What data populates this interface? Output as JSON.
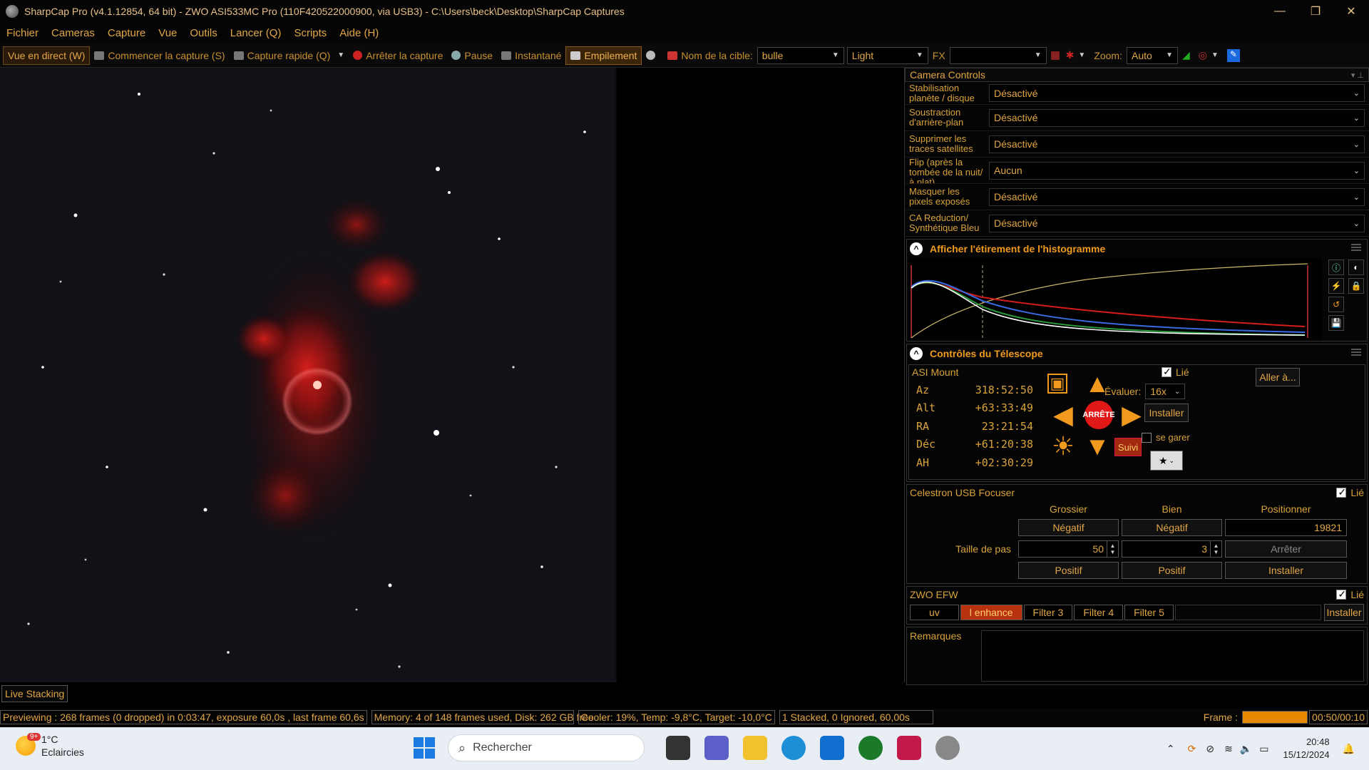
{
  "titlebar": {
    "title": "SharpCap Pro (v4.1.12854, 64 bit) - ZWO ASI533MC Pro (110F420522000900, via USB3) - C:\\Users\\beck\\Desktop\\SharpCap Captures",
    "minimize": "—",
    "maximize": "❐",
    "close": "✕"
  },
  "menu": [
    "Fichier",
    "Cameras",
    "Capture",
    "Vue",
    "Outils",
    "Lancer (Q)",
    "Scripts",
    "Aide (H)"
  ],
  "toolbar": {
    "live_view": "Vue en direct (W)",
    "start_capture": "Commencer la capture (S)",
    "quick_capture": "Capture rapide (Q)",
    "stop_capture": "Arrêter la capture",
    "pause": "Pause",
    "snapshot": "Instantané",
    "stacking": "Empilement",
    "target_label": "Nom de la cible:",
    "target_value": "bulle",
    "frame_type": "Light",
    "fx_label": "FX",
    "fx_value": "",
    "zoom_label": "Zoom:",
    "zoom_value": "Auto"
  },
  "panel": {
    "title": "Camera Controls",
    "settings": [
      {
        "label": "Stabilisation planète / disque",
        "value": "Désactivé"
      },
      {
        "label": "Soustraction d'arrière-plan",
        "value": "Désactivé"
      },
      {
        "label": "Supprimer les traces satellites",
        "value": "Désactivé"
      },
      {
        "label": "Flip (après la tombée de la nuit/à plat)",
        "value": "Aucun"
      },
      {
        "label": "Masquer les pixels exposés",
        "value": "Désactivé"
      },
      {
        "label": "CA Reduction/ Synthétique Bleu",
        "value": "Désactivé"
      }
    ],
    "histogram": {
      "title": "Afficher l'étirement de l'histogramme"
    },
    "telescope": {
      "title": "Contrôles du Télescope",
      "mount": "ASI Mount",
      "linked": "Lié",
      "goto": "Aller à...",
      "coords": [
        {
          "k": "Az",
          "v": "318:52:50"
        },
        {
          "k": "Alt",
          "v": "+63:33:49"
        },
        {
          "k": "RA",
          "v": "23:21:54"
        },
        {
          "k": "Déc",
          "v": "+61:20:38"
        },
        {
          "k": "AH",
          "v": "+02:30:29"
        }
      ],
      "rate_label": "Évaluer:",
      "rate_value": "16x",
      "install": "Installer",
      "park": "se garer",
      "stop": "ARRÊTE",
      "track": "Suivi"
    },
    "focuser": {
      "name": "Celestron USB Focuser",
      "linked": "Lié",
      "coarse": "Grossier",
      "fine": "Bien",
      "position_hdr": "Positionner",
      "negative": "Négatif",
      "positive": "Positif",
      "position": "19821",
      "step_label": "Taille de pas",
      "coarse_step": "50",
      "fine_step": "3",
      "stop": "Arrêter",
      "install": "Installer"
    },
    "efw": {
      "name": "ZWO EFW",
      "linked": "Lié",
      "filters": [
        "uv",
        "l enhance",
        "Filter 3",
        "Filter 4",
        "Filter 5"
      ],
      "selected": "l enhance",
      "install": "Installer"
    },
    "remarks_label": "Remarques"
  },
  "live_stacking_tab": "Live Stacking",
  "status": {
    "preview": "Previewing : 268 frames (0 dropped) in 0:03:47, exposure 60,0s , last frame 60,6s",
    "memory": "Memory: 4 of 148 frames used, Disk: 262 GB free",
    "cooler": "Cooler: 19%, Temp: -9,8°C, Target: -10,0°C",
    "stacked": "1 Stacked, 0 Ignored, 60,00s",
    "frame_label": "Frame :",
    "frame_time": "00:50/00:10"
  },
  "taskbar": {
    "weather_temp": "1°C",
    "weather_desc": "Eclaircies",
    "weather_badge": "9+",
    "search": "Rechercher",
    "time": "20:48",
    "date": "15/12/2024"
  },
  "colors": {
    "accent": "#f09a1e",
    "text": "#d9a23a",
    "selected": "#b83210",
    "background": "#000000"
  }
}
